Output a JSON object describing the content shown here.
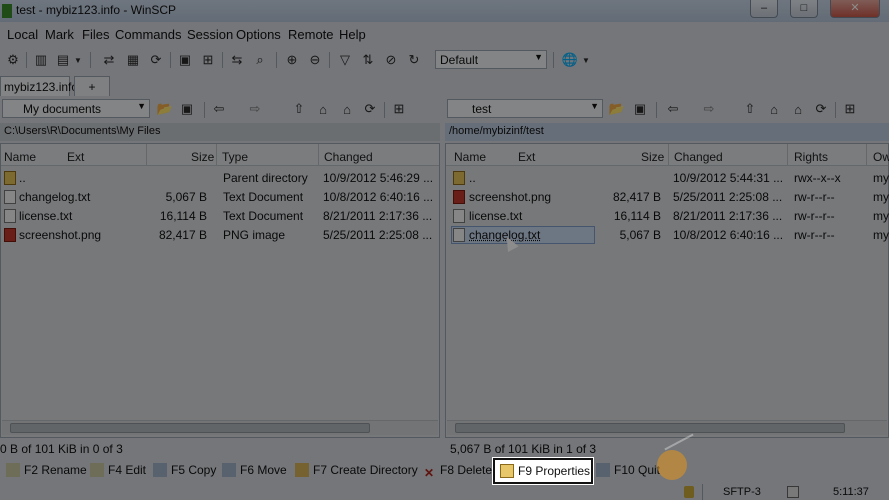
{
  "window": {
    "title": "test - mybiz123.info - WinSCP",
    "min": "–",
    "max": "□",
    "close": "✕"
  },
  "menu": [
    "Local",
    "Mark",
    "Files",
    "Commands",
    "Session",
    "Options",
    "Remote",
    "Help"
  ],
  "toolbar": {
    "transfer_settings": "Default"
  },
  "tabs": {
    "session": "mybiz123.info",
    "new": "+"
  },
  "left": {
    "location": "My documents",
    "path": "C:\\Users\\R\\Documents\\My Files",
    "columns": [
      "Name",
      "Ext",
      "Size",
      "Type",
      "Changed"
    ],
    "rows": [
      {
        "name": "..",
        "size": "",
        "type": "Parent directory",
        "changed": "10/9/2012  5:46:29 ..."
      },
      {
        "name": "changelog.txt",
        "size": "5,067 B",
        "type": "Text Document",
        "changed": "10/8/2012  6:40:16 ..."
      },
      {
        "name": "license.txt",
        "size": "16,114 B",
        "type": "Text Document",
        "changed": "8/21/2011  2:17:36 ..."
      },
      {
        "name": "screenshot.png",
        "size": "82,417 B",
        "type": "PNG image",
        "changed": "5/25/2011  2:25:08 ..."
      }
    ],
    "status": "0 B of 101 KiB in 0 of 3"
  },
  "right": {
    "location": "test",
    "path": "/home/mybizinf/test",
    "columns": [
      "Name",
      "Ext",
      "Size",
      "Changed",
      "Rights",
      "Ow"
    ],
    "rows": [
      {
        "name": "..",
        "size": "",
        "changed": "10/9/2012  5:44:31 ...",
        "rights": "rwx--x--x",
        "owner": "my"
      },
      {
        "name": "screenshot.png",
        "size": "82,417 B",
        "changed": "5/25/2011  2:25:08 ...",
        "rights": "rw-r--r--",
        "owner": "my"
      },
      {
        "name": "license.txt",
        "size": "16,114 B",
        "changed": "8/21/2011  2:17:36 ...",
        "rights": "rw-r--r--",
        "owner": "my"
      },
      {
        "name": "changelog.txt",
        "size": "5,067 B",
        "changed": "10/8/2012  6:40:16 ...",
        "rights": "rw-r--r--",
        "owner": "my"
      }
    ],
    "status": "5,067 B of 101 KiB in 1 of 3"
  },
  "commands": {
    "rename": "F2 Rename",
    "edit": "F4 Edit",
    "copy": "F5 Copy",
    "move": "F6 Move",
    "create_dir": "F7 Create Directory",
    "delete": "F8 Delete",
    "properties": "F9 Properties",
    "quit": "F10 Quit"
  },
  "statusbar": {
    "protocol": "SFTP-3",
    "time": "5:11:37"
  },
  "colors": {
    "highlight_border": "#111111",
    "selected_row": "#c7d7ee"
  }
}
